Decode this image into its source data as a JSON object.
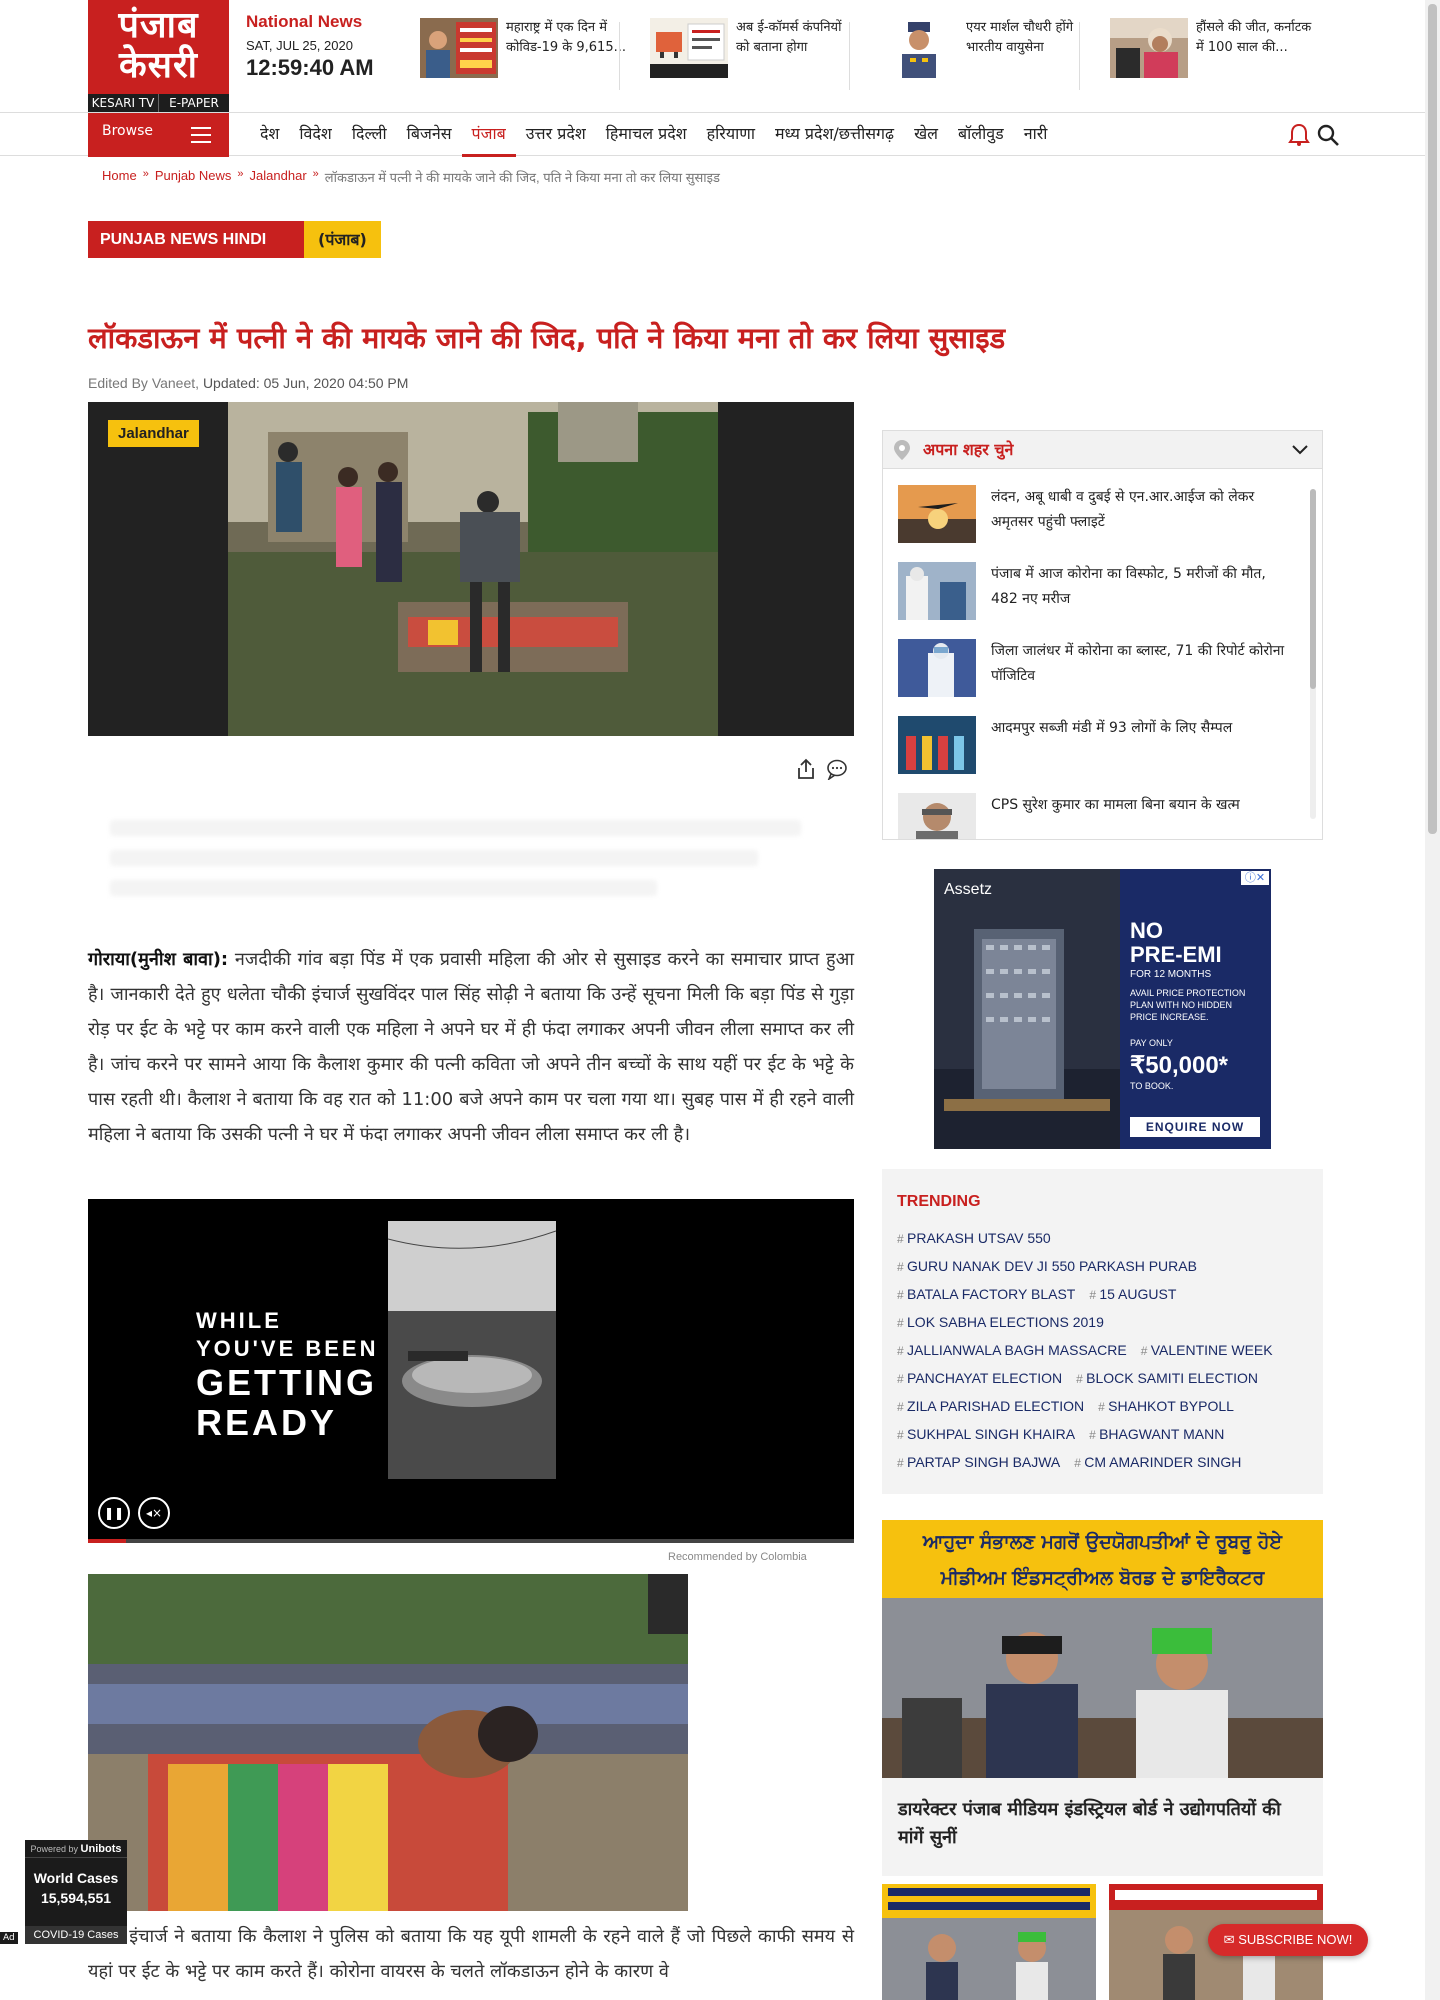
{
  "logo": {
    "hindi": "पंजाब केसरी",
    "line1": "पंजाब",
    "line2": "केसरी",
    "kesari_tv": "KESARI TV",
    "epaper": "E-PAPER"
  },
  "national": {
    "title": "National News",
    "date": "SAT, JUL 25, 2020",
    "time": "12:59:40 AM"
  },
  "top_stories": [
    {
      "text": "महाराष्ट्र में एक दिन में कोविड-19 के 9,615..."
    },
    {
      "text": "अब ई-कॉमर्स कंपनियों को बताना होगा"
    },
    {
      "text": "एयर मार्शल चौधरी होंगे भारतीय वायुसेना"
    },
    {
      "text": "हौंसले की जीत, कर्नाटक में 100 साल की..."
    }
  ],
  "nav": {
    "browse": "Browse",
    "items": [
      "देश",
      "विदेश",
      "दिल्ली",
      "बिजनेस",
      "पंजाब",
      "उत्तर प्रदेश",
      "हिमाचल प्रदेश",
      "हरियाणा",
      "मध्य प्रदेश/छत्तीसगढ़",
      "खेल",
      "बॉलीवुड",
      "नारी"
    ],
    "active": "पंजाब"
  },
  "breadcrumb": {
    "home": "Home",
    "punjab": "Punjab News",
    "city": "Jalandhar",
    "current": "लॉकडाऊन में पत्नी ने की मायके जाने की जिद, पति ने किया मना तो कर लिया सुसाइड"
  },
  "category": {
    "english": "PUNJAB NEWS HINDI",
    "hindi": "(पंजाब)"
  },
  "article": {
    "headline": "लॉकडाऊन में पत्नी ने की मायके जाने की जिद, पति ने किया मना तो कर लिया सुसाइड",
    "edited_by": "Edited By Vaneet,",
    "updated": "Updated: 05 Jun, 2020 04:50 PM",
    "city_tag": "Jalandhar",
    "dateline": "गोराया(मुनीश बावा):",
    "para1": " नजदीकी गांव बड़ा पिंड में एक प्रवासी महिला की ओर से सुसाइड करने का समाचार प्राप्त हुआ है। जानकारी देते हुए धलेता चौकी इंचार्ज सुखविंदर पाल सिंह सोढ़ी ने बताया कि उन्हें सूचना मिली कि बड़ा पिंड से गुड़ा रोड़ पर ईट के भट्टे पर काम करने वाली एक महिला ने अपने घर में ही फंदा लगाकर अपनी जीवन लीला समाप्त कर ली है। जांच करने पर सामने आया कि कैलाश कुमार की पत्नी कविता जो अपने तीन बच्चों के साथ यहीं पर ईट के भट्टे के पास रहती थी। कैलाश ने बताया कि वह रात को 11:00 बजे अपने काम पर चला गया था। सुबह पास में ही रहने वाली महिला ने बताया कि उसकी पत्नी ने घर में फंदा लगाकर अपनी जीवन लीला समाप्त कर ली है।",
    "para2": "चौकी इंचार्ज ने बताया कि कैलाश ने पुलिस को बताया कि यह यूपी शामली के रहने वाले हैं जो पिछले काफी समय से यहां पर ईट के भट्टे पर काम करते हैं। कोरोना वायरस के चलते लॉकडाऊन होने के कारण वे"
  },
  "video": {
    "line1": "WHILE",
    "line2": "YOU'VE BEEN",
    "line3": "GETTING",
    "line4": "READY",
    "progress": 0.05,
    "recommended": "Recommended by Colombia"
  },
  "city_widget": {
    "label": "अपना शहर चुने",
    "items": [
      "लंदन, अबू धाबी व दुबई से एन.आर.आईज को लेकर अमृतसर पहुंची फ्लाइटें",
      "पंजाब में आज कोरोना का विस्फोट, 5 मरीजों की मौत, 482 नए मरीज",
      "जिला जालंधर में कोरोना का ब्लास्ट, 71 की रिपोर्ट कोरोना पॉजिटिव",
      "आदमपुर सब्जी मंडी में 93 लोगों के लिए सैम्पल",
      "CPS सुरेश कुमार का मामला बिना बयान के खत्म"
    ]
  },
  "side_ad": {
    "brand": "Assetz",
    "line1": "NO",
    "line2": "PRE-EMI",
    "line3": "FOR 12 MONTHS",
    "small": "AVAIL PRICE PROTECTION PLAN WITH NO HIDDEN PRICE INCREASE.",
    "pay": "PAY ONLY",
    "price": "₹50,000*",
    "to_book": "TO BOOK.",
    "cta": "ENQUIRE NOW"
  },
  "trending": {
    "title": "TRENDING",
    "tags": [
      "PRAKASH UTSAV 550",
      "GURU NANAK DEV JI 550 PARKASH PURAB",
      "BATALA FACTORY BLAST",
      "15 AUGUST",
      "LOK SABHA ELECTIONS 2019",
      "JALLIANWALA BAGH MASSACRE",
      "VALENTINE WEEK",
      "PANCHAYAT ELECTION",
      "BLOCK SAMITI ELECTION",
      "ZILA PARISHAD ELECTION",
      "SHAHKOT BYPOLL",
      "SUKHPAL SINGH KHAIRA",
      "BHAGWANT MANN",
      "PARTAP SINGH BAJWA",
      "CM AMARINDER SINGH"
    ]
  },
  "video_card": {
    "banner1": "ਆਹੁਦਾ ਸੰਭਾਲਣ ਮਗਰੋਂ ਉਦਯੋਗਪਤੀਆਂ ਦੇ ਰੂਬਰੂ ਹੋਏ",
    "banner2": "ਮੀਡੀਅਮ ਇੰਡਸਟ੍ਰੀਅਲ ਬੋਰਡ ਦੇ ਡਾਇਰੈਕਟਰ",
    "caption": "डायरेक्टर पंजाब मीडियम इंडस्ट्रियल बोर्ड ने उद्योगपतियों की मांगें सुनीं"
  },
  "covid": {
    "powered": "Powered by",
    "brand": "Unibots",
    "label": "World Cases",
    "count": "15,594,551",
    "footer": "COVID-19 Cases",
    "ad": "Ad"
  },
  "subscribe": "SUBSCRIBE NOW!",
  "colors": {
    "brand_red": "#c8201f",
    "accent_yellow": "#f6c10e",
    "navy": "#1a2a66"
  }
}
